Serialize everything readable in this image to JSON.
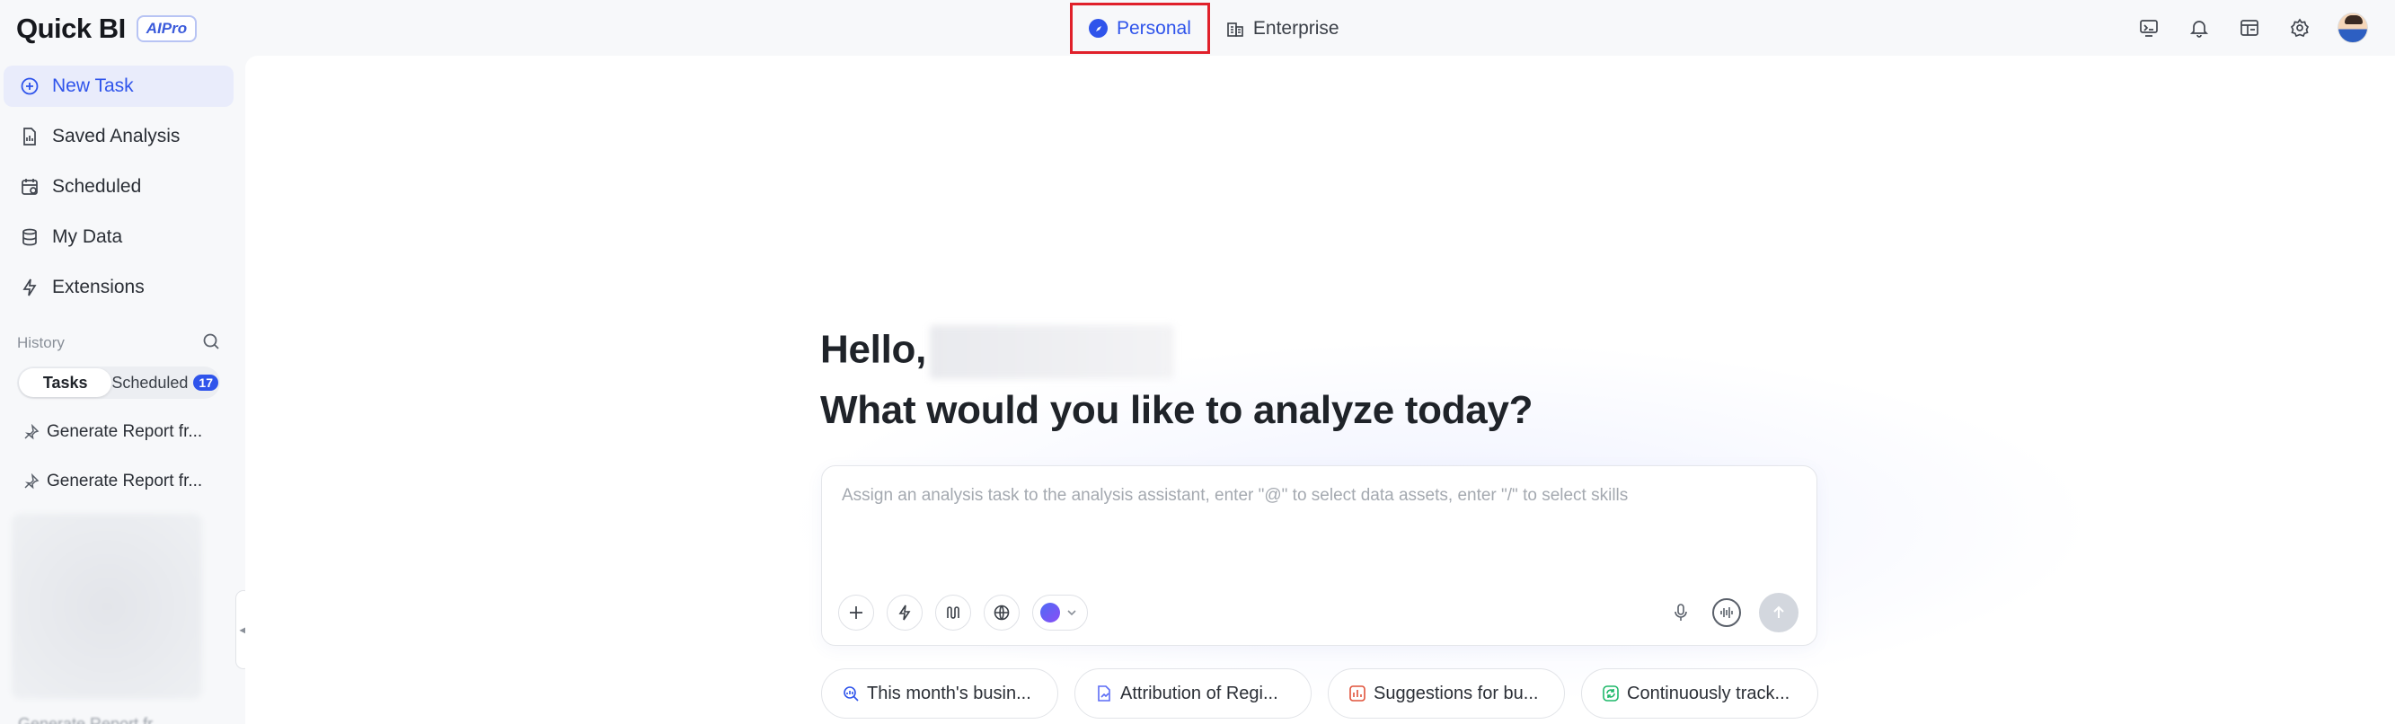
{
  "app": {
    "logo_text": "Quick BI",
    "logo_badge": "AIPro"
  },
  "mode_switch": {
    "personal": "Personal",
    "enterprise": "Enterprise",
    "selected": "Personal"
  },
  "top_icons": [
    "monitor-icon",
    "bell-icon",
    "dashboard-icon",
    "gear-icon",
    "avatar"
  ],
  "sidebar": {
    "items": [
      {
        "label": "New Task",
        "icon": "plus-circle-icon"
      },
      {
        "label": "Saved Analysis",
        "icon": "document-icon"
      },
      {
        "label": "Scheduled",
        "icon": "calendar-clock-icon"
      },
      {
        "label": "My Data",
        "icon": "database-icon"
      },
      {
        "label": "Extensions",
        "icon": "lightning-icon"
      }
    ],
    "history_label": "History",
    "tabs": {
      "tasks": "Tasks",
      "scheduled": "Scheduled",
      "scheduled_count": "17"
    },
    "history_items": [
      {
        "label": "Generate Report fr..."
      },
      {
        "label": "Generate Report fr..."
      }
    ],
    "partial_item": "Generate Report fr..."
  },
  "main": {
    "greeting": "Hello,",
    "question": "What would you like to analyze today?",
    "input_placeholder": "Assign an analysis task to the analysis assistant, enter \"@\" to select data assets, enter \"/\" to select skills",
    "suggestions": [
      {
        "label": "This month's busin...",
        "icon": "chart-search-icon",
        "color": "#2f54eb"
      },
      {
        "label": "Attribution of Regi...",
        "icon": "document-chart-icon",
        "color": "#5b6cf5"
      },
      {
        "label": "Suggestions for bu...",
        "icon": "bar-chart-icon",
        "color": "#e0523a"
      },
      {
        "label": "Continuously track...",
        "icon": "refresh-icon",
        "color": "#1fb86a"
      }
    ]
  },
  "colors": {
    "accent": "#2f54eb",
    "highlight_border": "#e0202a"
  }
}
